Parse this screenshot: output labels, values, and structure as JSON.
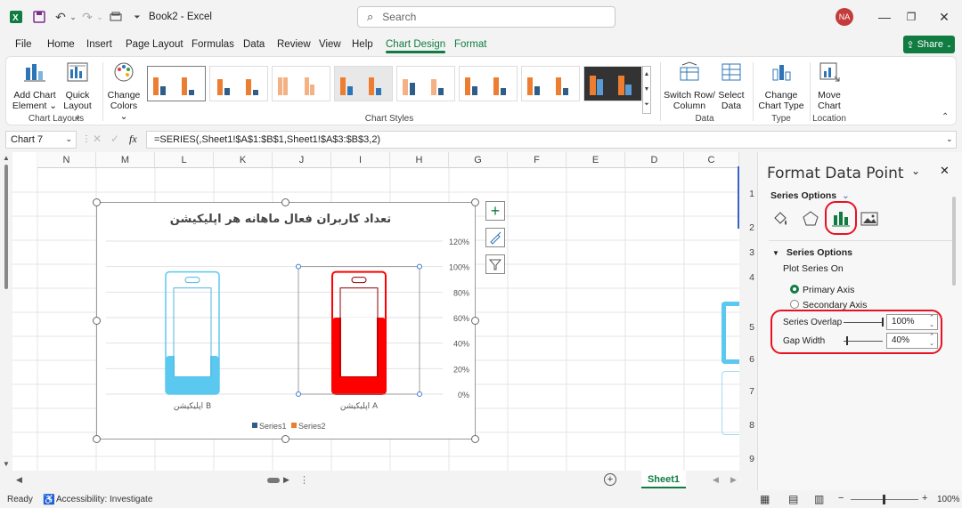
{
  "title_bar": {
    "doc_title": "Book2 - Excel",
    "search_placeholder": "Search",
    "avatar_initials": "NA"
  },
  "menu": {
    "items": [
      "File",
      "Home",
      "Insert",
      "Page Layout",
      "Formulas",
      "Data",
      "Review",
      "View",
      "Help",
      "Chart Design",
      "Format"
    ],
    "active": "Chart Design",
    "share_label": "Share"
  },
  "ribbon": {
    "add_chart_element": [
      "Add Chart",
      "Element ⌄"
    ],
    "quick_layout": [
      "Quick",
      "Layout ⌄"
    ],
    "change_colors": [
      "Change",
      "Colors ⌄"
    ],
    "chart_layouts_label": "Chart Layouts",
    "chart_styles_label": "Chart Styles",
    "switch_row_column": [
      "Switch Row/",
      "Column"
    ],
    "select_data": [
      "Select",
      "Data"
    ],
    "data_label": "Data",
    "change_chart_type": [
      "Change",
      "Chart Type"
    ],
    "type_label": "Type",
    "move_chart": [
      "Move",
      "Chart"
    ],
    "location_label": "Location"
  },
  "formula_bar": {
    "name_box": "Chart 7",
    "formula": "=SERIES(,Sheet1!$A$1:$B$1,Sheet1!$A$3:$B$3,2)"
  },
  "grid": {
    "columns": [
      "N",
      "M",
      "L",
      "K",
      "J",
      "I",
      "H",
      "G",
      "F",
      "E",
      "D",
      "C"
    ],
    "rows": [
      "1",
      "2",
      "3",
      "4",
      "5",
      "6",
      "7",
      "8",
      "9"
    ]
  },
  "chart_data": {
    "type": "bar",
    "title": "تعداد کاربران فعال ماهانه هر اپلیکیشن",
    "categories": [
      "اپلیکیشن A",
      "اپلیکیشن B"
    ],
    "series": [
      {
        "name": "Series1",
        "values": [
          1.0,
          1.0
        ]
      },
      {
        "name": "Series2",
        "values": [
          0.6,
          0.3
        ]
      }
    ],
    "y_ticks": [
      "120%",
      "100%",
      "80%",
      "60%",
      "40%",
      "20%",
      "0%"
    ],
    "ylim": [
      0,
      1.2
    ],
    "axis_side": "right",
    "legend_position": "bottom",
    "series_colors": {
      "A": "#ff0000",
      "B": "#5bc8f0"
    }
  },
  "sheet_tabs": {
    "active": "Sheet1"
  },
  "status_bar": {
    "ready": "Ready",
    "accessibility": "Accessibility: Investigate",
    "zoom": "100%"
  },
  "format_pane": {
    "title": "Format Data Point",
    "series_options_dropdown": "Series Options",
    "section_title": "Series Options",
    "plot_series_on": "Plot Series On",
    "primary_axis": "Primary Axis",
    "secondary_axis": "Secondary Axis",
    "series_overlap_label": "Series Overlap",
    "series_overlap_value": "100%",
    "series_overlap_level": 1.0,
    "gap_width_label": "Gap Width",
    "gap_width_value": "40%",
    "gap_width_level": 0.08
  }
}
